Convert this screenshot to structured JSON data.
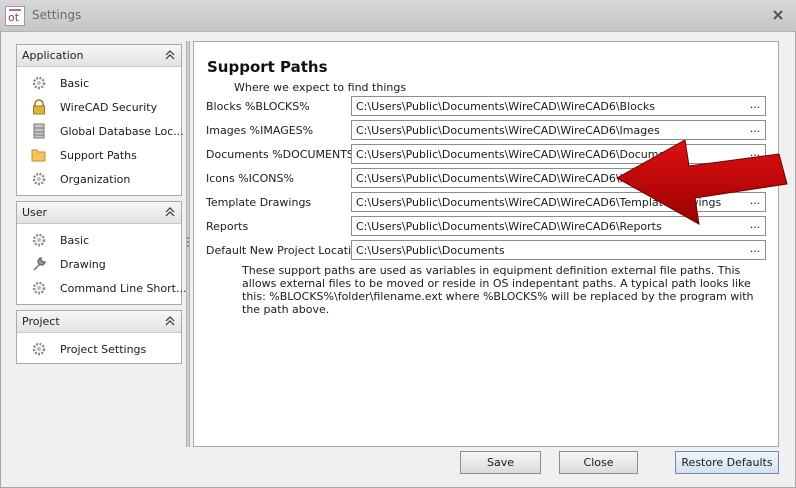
{
  "window": {
    "title": "Settings"
  },
  "sidebar": {
    "groups": [
      {
        "label": "Application",
        "items": [
          {
            "label": "Basic",
            "icon": "gear-icon"
          },
          {
            "label": "WireCAD Security",
            "icon": "lock-icon"
          },
          {
            "label": "Global Database Loc...",
            "icon": "database-icon"
          },
          {
            "label": "Support Paths",
            "icon": "folder-icon"
          },
          {
            "label": "Organization",
            "icon": "gear-icon"
          }
        ]
      },
      {
        "label": "User",
        "items": [
          {
            "label": "Basic",
            "icon": "gear-icon"
          },
          {
            "label": "Drawing",
            "icon": "wrench-icon"
          },
          {
            "label": "Command Line Short...",
            "icon": "gear-icon"
          }
        ]
      },
      {
        "label": "Project",
        "items": [
          {
            "label": "Project Settings",
            "icon": "gear-icon"
          }
        ]
      }
    ]
  },
  "main": {
    "title": "Support Paths",
    "subtitle": "Where we expect to find things",
    "rows": [
      {
        "label": "Blocks %BLOCKS%",
        "value": "C:\\Users\\Public\\Documents\\WireCAD\\WireCAD6\\Blocks"
      },
      {
        "label": "Images %IMAGES%",
        "value": "C:\\Users\\Public\\Documents\\WireCAD\\WireCAD6\\Images"
      },
      {
        "label": "Documents %DOCUMENTS%",
        "value": "C:\\Users\\Public\\Documents\\WireCAD\\WireCAD6\\Documents"
      },
      {
        "label": "Icons %ICONS%",
        "value": "C:\\Users\\Public\\Documents\\WireCAD\\WireCAD6\\Icons"
      },
      {
        "label": "Template Drawings",
        "value": "C:\\Users\\Public\\Documents\\WireCAD\\WireCAD6\\TemplateDrawings"
      },
      {
        "label": "Reports",
        "value": "C:\\Users\\Public\\Documents\\WireCAD\\WireCAD6\\Reports"
      },
      {
        "label": "Default New Project Location",
        "value": "C:\\Users\\Public\\Documents"
      }
    ],
    "browse_label": "...",
    "help_text": "These support paths are used as variables in equipment definition external file paths. This allows external files to be moved or reside in OS indepentant paths. A typical path looks like this: %BLOCKS%\\folder\\filename.ext where %BLOCKS% will be replaced by the program with the path above."
  },
  "footer": {
    "save_label": "Save",
    "close_label": "Close",
    "restore_label": "Restore Defaults"
  },
  "colors": {
    "arrow": "#c40000",
    "primary_border": "#6b8cb0"
  }
}
